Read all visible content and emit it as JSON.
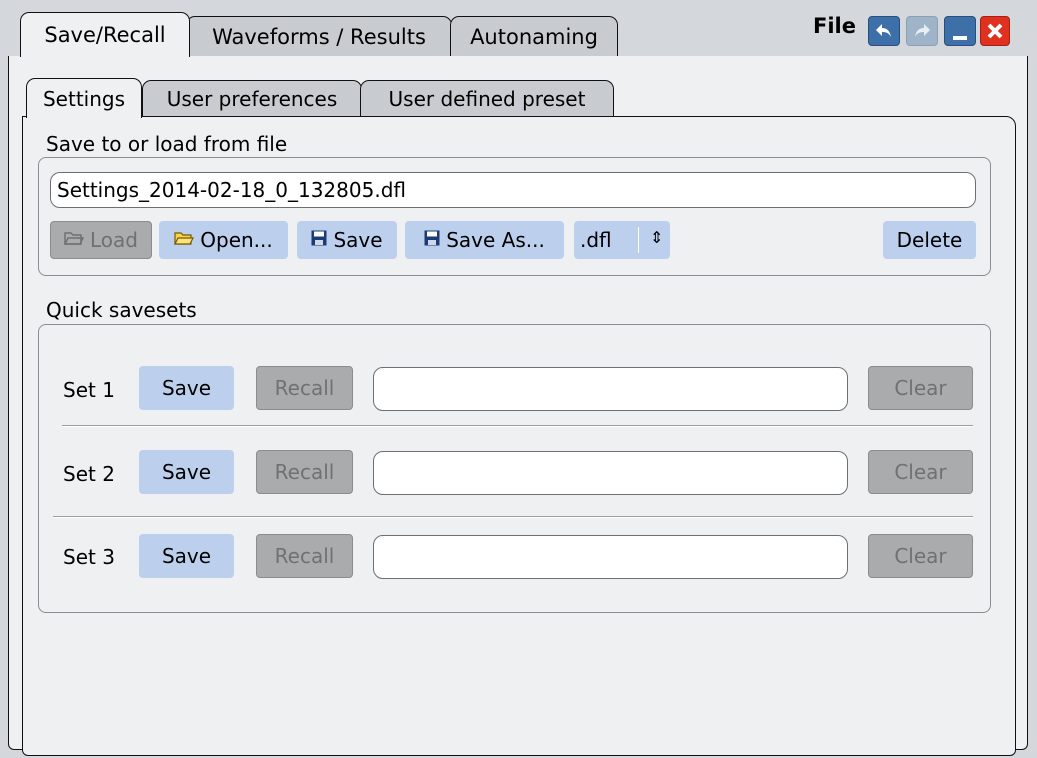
{
  "tabs": [
    {
      "label": "Save/Recall",
      "active": true
    },
    {
      "label": "Waveforms / Results",
      "active": false
    },
    {
      "label": "Autonaming",
      "active": false
    }
  ],
  "window": {
    "title": "File",
    "buttons": [
      "undo-icon",
      "redo-icon",
      "minimize-icon",
      "close-icon"
    ]
  },
  "subtabs": [
    {
      "label": "Settings",
      "active": true
    },
    {
      "label": "User preferences",
      "active": false
    },
    {
      "label": "User defined preset",
      "active": false
    }
  ],
  "file_group": {
    "title": "Save to or load from file",
    "filename": "Settings_2014-02-18_0_132805.dfl",
    "load_label": "Load",
    "open_label": "Open...",
    "save_label": "Save",
    "save_as_label": "Save As...",
    "extension": ".dfl",
    "delete_label": "Delete"
  },
  "quick_group": {
    "title": "Quick savesets",
    "sets": [
      {
        "label": "Set 1",
        "save": "Save",
        "recall": "Recall",
        "name": "",
        "clear": "Clear"
      },
      {
        "label": "Set 2",
        "save": "Save",
        "recall": "Recall",
        "name": "",
        "clear": "Clear"
      },
      {
        "label": "Set 3",
        "save": "Save",
        "recall": "Recall",
        "name": "",
        "clear": "Clear"
      }
    ]
  },
  "colors": {
    "button_bg": "#bcd0ee",
    "close_red": "#e03020",
    "window_btn_blue": "#3d6fa8"
  }
}
